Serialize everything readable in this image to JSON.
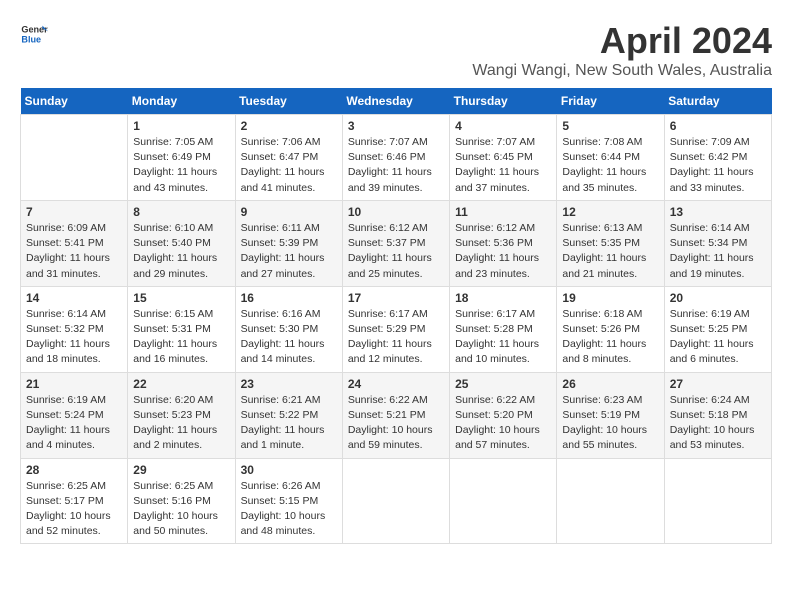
{
  "header": {
    "logo_line1": "General",
    "logo_line2": "Blue",
    "title": "April 2024",
    "subtitle": "Wangi Wangi, New South Wales, Australia"
  },
  "days_of_week": [
    "Sunday",
    "Monday",
    "Tuesday",
    "Wednesday",
    "Thursday",
    "Friday",
    "Saturday"
  ],
  "weeks": [
    [
      {
        "day": "",
        "content": ""
      },
      {
        "day": "1",
        "content": "Sunrise: 7:05 AM\nSunset: 6:49 PM\nDaylight: 11 hours\nand 43 minutes."
      },
      {
        "day": "2",
        "content": "Sunrise: 7:06 AM\nSunset: 6:47 PM\nDaylight: 11 hours\nand 41 minutes."
      },
      {
        "day": "3",
        "content": "Sunrise: 7:07 AM\nSunset: 6:46 PM\nDaylight: 11 hours\nand 39 minutes."
      },
      {
        "day": "4",
        "content": "Sunrise: 7:07 AM\nSunset: 6:45 PM\nDaylight: 11 hours\nand 37 minutes."
      },
      {
        "day": "5",
        "content": "Sunrise: 7:08 AM\nSunset: 6:44 PM\nDaylight: 11 hours\nand 35 minutes."
      },
      {
        "day": "6",
        "content": "Sunrise: 7:09 AM\nSunset: 6:42 PM\nDaylight: 11 hours\nand 33 minutes."
      }
    ],
    [
      {
        "day": "7",
        "content": "Sunrise: 6:09 AM\nSunset: 5:41 PM\nDaylight: 11 hours\nand 31 minutes."
      },
      {
        "day": "8",
        "content": "Sunrise: 6:10 AM\nSunset: 5:40 PM\nDaylight: 11 hours\nand 29 minutes."
      },
      {
        "day": "9",
        "content": "Sunrise: 6:11 AM\nSunset: 5:39 PM\nDaylight: 11 hours\nand 27 minutes."
      },
      {
        "day": "10",
        "content": "Sunrise: 6:12 AM\nSunset: 5:37 PM\nDaylight: 11 hours\nand 25 minutes."
      },
      {
        "day": "11",
        "content": "Sunrise: 6:12 AM\nSunset: 5:36 PM\nDaylight: 11 hours\nand 23 minutes."
      },
      {
        "day": "12",
        "content": "Sunrise: 6:13 AM\nSunset: 5:35 PM\nDaylight: 11 hours\nand 21 minutes."
      },
      {
        "day": "13",
        "content": "Sunrise: 6:14 AM\nSunset: 5:34 PM\nDaylight: 11 hours\nand 19 minutes."
      }
    ],
    [
      {
        "day": "14",
        "content": "Sunrise: 6:14 AM\nSunset: 5:32 PM\nDaylight: 11 hours\nand 18 minutes."
      },
      {
        "day": "15",
        "content": "Sunrise: 6:15 AM\nSunset: 5:31 PM\nDaylight: 11 hours\nand 16 minutes."
      },
      {
        "day": "16",
        "content": "Sunrise: 6:16 AM\nSunset: 5:30 PM\nDaylight: 11 hours\nand 14 minutes."
      },
      {
        "day": "17",
        "content": "Sunrise: 6:17 AM\nSunset: 5:29 PM\nDaylight: 11 hours\nand 12 minutes."
      },
      {
        "day": "18",
        "content": "Sunrise: 6:17 AM\nSunset: 5:28 PM\nDaylight: 11 hours\nand 10 minutes."
      },
      {
        "day": "19",
        "content": "Sunrise: 6:18 AM\nSunset: 5:26 PM\nDaylight: 11 hours\nand 8 minutes."
      },
      {
        "day": "20",
        "content": "Sunrise: 6:19 AM\nSunset: 5:25 PM\nDaylight: 11 hours\nand 6 minutes."
      }
    ],
    [
      {
        "day": "21",
        "content": "Sunrise: 6:19 AM\nSunset: 5:24 PM\nDaylight: 11 hours\nand 4 minutes."
      },
      {
        "day": "22",
        "content": "Sunrise: 6:20 AM\nSunset: 5:23 PM\nDaylight: 11 hours\nand 2 minutes."
      },
      {
        "day": "23",
        "content": "Sunrise: 6:21 AM\nSunset: 5:22 PM\nDaylight: 11 hours\nand 1 minute."
      },
      {
        "day": "24",
        "content": "Sunrise: 6:22 AM\nSunset: 5:21 PM\nDaylight: 10 hours\nand 59 minutes."
      },
      {
        "day": "25",
        "content": "Sunrise: 6:22 AM\nSunset: 5:20 PM\nDaylight: 10 hours\nand 57 minutes."
      },
      {
        "day": "26",
        "content": "Sunrise: 6:23 AM\nSunset: 5:19 PM\nDaylight: 10 hours\nand 55 minutes."
      },
      {
        "day": "27",
        "content": "Sunrise: 6:24 AM\nSunset: 5:18 PM\nDaylight: 10 hours\nand 53 minutes."
      }
    ],
    [
      {
        "day": "28",
        "content": "Sunrise: 6:25 AM\nSunset: 5:17 PM\nDaylight: 10 hours\nand 52 minutes."
      },
      {
        "day": "29",
        "content": "Sunrise: 6:25 AM\nSunset: 5:16 PM\nDaylight: 10 hours\nand 50 minutes."
      },
      {
        "day": "30",
        "content": "Sunrise: 6:26 AM\nSunset: 5:15 PM\nDaylight: 10 hours\nand 48 minutes."
      },
      {
        "day": "",
        "content": ""
      },
      {
        "day": "",
        "content": ""
      },
      {
        "day": "",
        "content": ""
      },
      {
        "day": "",
        "content": ""
      }
    ]
  ]
}
